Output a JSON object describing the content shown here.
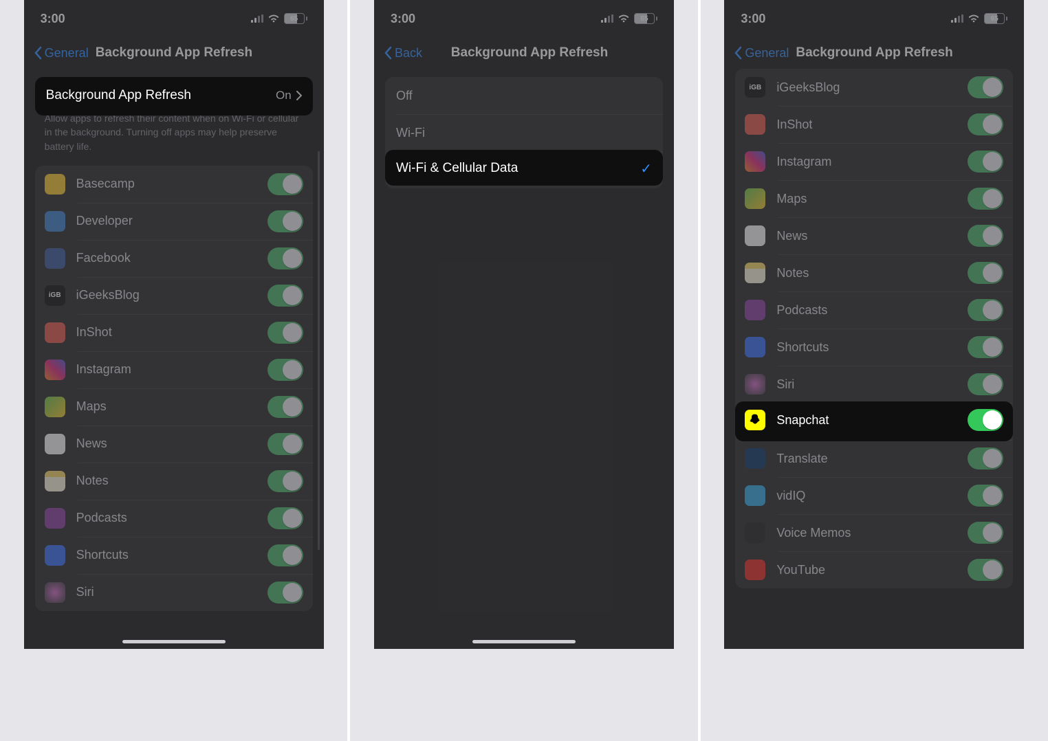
{
  "status": {
    "time": "3:00",
    "battery": "65"
  },
  "screen1": {
    "back": "General",
    "title": "Background App Refresh",
    "mainRow": {
      "label": "Background App Refresh",
      "value": "On"
    },
    "footer": "Allow apps to refresh their content when on Wi-Fi or cellular in the background. Turning off apps may help preserve battery life.",
    "apps": [
      {
        "name": "Basecamp",
        "cls": "ic-basecamp"
      },
      {
        "name": "Developer",
        "cls": "ic-dev"
      },
      {
        "name": "Facebook",
        "cls": "ic-fb"
      },
      {
        "name": "iGeeksBlog",
        "cls": "ic-igb"
      },
      {
        "name": "InShot",
        "cls": "ic-inshot"
      },
      {
        "name": "Instagram",
        "cls": "ic-ig"
      },
      {
        "name": "Maps",
        "cls": "ic-maps"
      },
      {
        "name": "News",
        "cls": "ic-news"
      },
      {
        "name": "Notes",
        "cls": "ic-notes"
      },
      {
        "name": "Podcasts",
        "cls": "ic-pod"
      },
      {
        "name": "Shortcuts",
        "cls": "ic-sc"
      },
      {
        "name": "Siri",
        "cls": "ic-siri"
      }
    ]
  },
  "screen2": {
    "back": "Back",
    "title": "Background App Refresh",
    "options": [
      "Off",
      "Wi-Fi",
      "Wi-Fi & Cellular Data"
    ],
    "selected": 2
  },
  "screen3": {
    "back": "General",
    "title": "Background App Refresh",
    "apps": [
      {
        "name": "iGeeksBlog",
        "cls": "ic-igb"
      },
      {
        "name": "InShot",
        "cls": "ic-inshot"
      },
      {
        "name": "Instagram",
        "cls": "ic-ig"
      },
      {
        "name": "Maps",
        "cls": "ic-maps"
      },
      {
        "name": "News",
        "cls": "ic-news"
      },
      {
        "name": "Notes",
        "cls": "ic-notes"
      },
      {
        "name": "Podcasts",
        "cls": "ic-pod"
      },
      {
        "name": "Shortcuts",
        "cls": "ic-sc"
      },
      {
        "name": "Siri",
        "cls": "ic-siri"
      },
      {
        "name": "Snapchat",
        "cls": "ic-snap",
        "highlight": true
      },
      {
        "name": "Translate",
        "cls": "ic-tr"
      },
      {
        "name": "vidIQ",
        "cls": "ic-vidiq"
      },
      {
        "name": "Voice Memos",
        "cls": "ic-vm"
      },
      {
        "name": "YouTube",
        "cls": "ic-yt"
      }
    ]
  }
}
